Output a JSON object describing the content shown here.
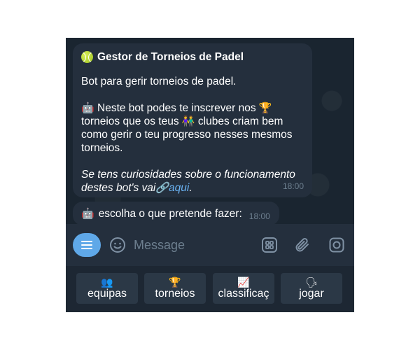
{
  "chat": {
    "message1": {
      "title": "Gestor de Torneios de Padel",
      "intro": "Bot para gerir torneios de padel.",
      "body_part1": "Neste bot podes te inscrever nos",
      "body_part2": "torneios que os teus",
      "body_part3": "clubes criam bem como gerir o teu progresso nesses mesmos torneios.",
      "footer_text": "Se tens curiosidades sobre o funcionamento destes bot's vai",
      "link_text": "aqui",
      "footer_end": ".",
      "time": "18:00"
    },
    "message2": {
      "text": "escolha o que pretende fazer:",
      "time": "18:00"
    }
  },
  "input": {
    "placeholder": "Message"
  },
  "keyboard": {
    "buttons": [
      {
        "icon": "👥",
        "label": "equipas"
      },
      {
        "icon": "🏆",
        "label": "torneios"
      },
      {
        "icon": "📈",
        "label": "classificaç"
      },
      {
        "icon": "🗣",
        "label": "jogar"
      }
    ]
  },
  "icons": {
    "bot": "🤖",
    "trophy": "🏆",
    "people": "👫",
    "link": "🔗"
  },
  "colors": {
    "accent": "#5fa8e8",
    "link": "#6ab3f3",
    "bubble": "#242f3d",
    "background": "#1d2733"
  }
}
